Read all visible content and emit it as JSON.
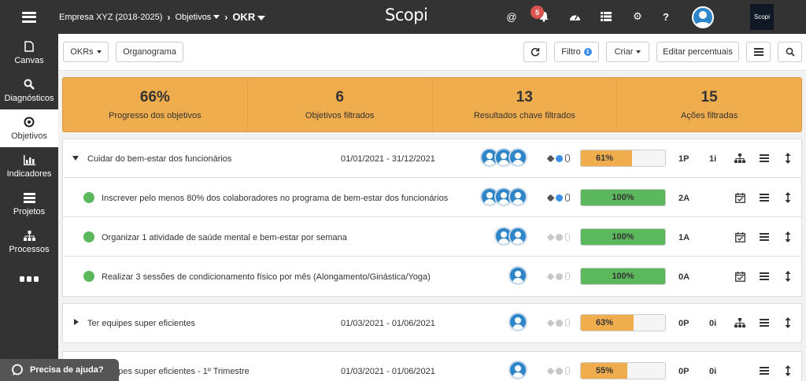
{
  "topbar": {
    "breadcrumb_company": "Empresa XYZ (2018-2025)",
    "breadcrumb_objetivos": "Objetivos",
    "breadcrumb_okr": "OKR",
    "brand": "Scopi",
    "notifications_count": "5",
    "tenant_logo_text": "Scopi",
    "icons": [
      "hamburger-icon",
      "at-icon",
      "bell-icon",
      "dashboard-icon",
      "list-icon",
      "gear-icon",
      "help-icon",
      "user-avatar"
    ]
  },
  "sidebar": {
    "items": [
      {
        "label": "Canvas",
        "icon": "canvas-icon"
      },
      {
        "label": "Diagnósticos",
        "icon": "search-icon"
      },
      {
        "label": "Objetivos",
        "icon": "target-icon",
        "active": true
      },
      {
        "label": "Indicadores",
        "icon": "bar-chart-icon"
      },
      {
        "label": "Projetos",
        "icon": "projects-icon"
      },
      {
        "label": "Processos",
        "icon": "sitemap-icon"
      },
      {
        "label": "",
        "icon": "more-icon"
      }
    ],
    "help_label": "Precisa de ajuda?"
  },
  "toolbar": {
    "okrs_label": "OKRs",
    "organograma_label": "Organograma",
    "filtro_label": "Filtro",
    "filtro_badge": "1",
    "criar_label": "Criar",
    "editar_label": "Editar percentuais"
  },
  "stats": [
    {
      "value": "66%",
      "label": "Progresso dos objetivos"
    },
    {
      "value": "6",
      "label": "Objetivos filtrados"
    },
    {
      "value": "13",
      "label": "Resultados chave filtrados"
    },
    {
      "value": "15",
      "label": "Ações filtradas"
    }
  ],
  "groups": [
    {
      "rows": [
        {
          "type": "objective",
          "expanded": true,
          "title": "Cuidar do bem-estar dos funcionários",
          "dates": "01/01/2021 - 31/12/2021",
          "avatars": 3,
          "meta_dim": false,
          "progress": 61,
          "progress_label": "61%",
          "progress_color": "#f0ad4e",
          "code": "1P",
          "initiatives": "1i",
          "action_icon": "sitemap-icon"
        },
        {
          "type": "kr",
          "title": "Inscrever pelo menos 80% dos colaboradores no programa de bem-estar dos funcionários",
          "avatars": 3,
          "meta_dim": false,
          "progress": 100,
          "progress_label": "100%",
          "progress_color": "#5cb85c",
          "code": "2A",
          "action_icon": "calendar-check-icon"
        },
        {
          "type": "kr",
          "title": "Organizar 1 atividade de saúde mental e bem-estar por semana",
          "avatars": 2,
          "meta_dim": true,
          "progress": 100,
          "progress_label": "100%",
          "progress_color": "#5cb85c",
          "code": "1A",
          "action_icon": "calendar-check-icon"
        },
        {
          "type": "kr",
          "title": "Realizar 3 sessões de condicionamento físico por mês (Alongamento/Ginástica/Yoga)",
          "avatars": 1,
          "meta_dim": true,
          "progress": 100,
          "progress_label": "100%",
          "progress_color": "#5cb85c",
          "code": "0A",
          "action_icon": "calendar-check-icon"
        }
      ]
    },
    {
      "rows": [
        {
          "type": "objective",
          "expanded": false,
          "title": "Ter equipes super eficientes",
          "dates": "01/03/2021 - 01/06/2021",
          "avatars": 1,
          "meta_dim": true,
          "progress": 63,
          "progress_label": "63%",
          "progress_color": "#f0ad4e",
          "code": "0P",
          "initiatives": "0i",
          "action_icon": "sitemap-icon"
        }
      ]
    },
    {
      "rows": [
        {
          "type": "objective",
          "expanded": false,
          "title": "Ter equipes super eficientes - 1º Trimestre",
          "dates": "01/03/2021 - 01/06/2021",
          "avatars": 1,
          "meta_dim": true,
          "progress": 55,
          "progress_label": "55%",
          "progress_color": "#f0ad4e",
          "code": "0P",
          "initiatives": "0i",
          "action_icon": ""
        }
      ]
    }
  ]
}
